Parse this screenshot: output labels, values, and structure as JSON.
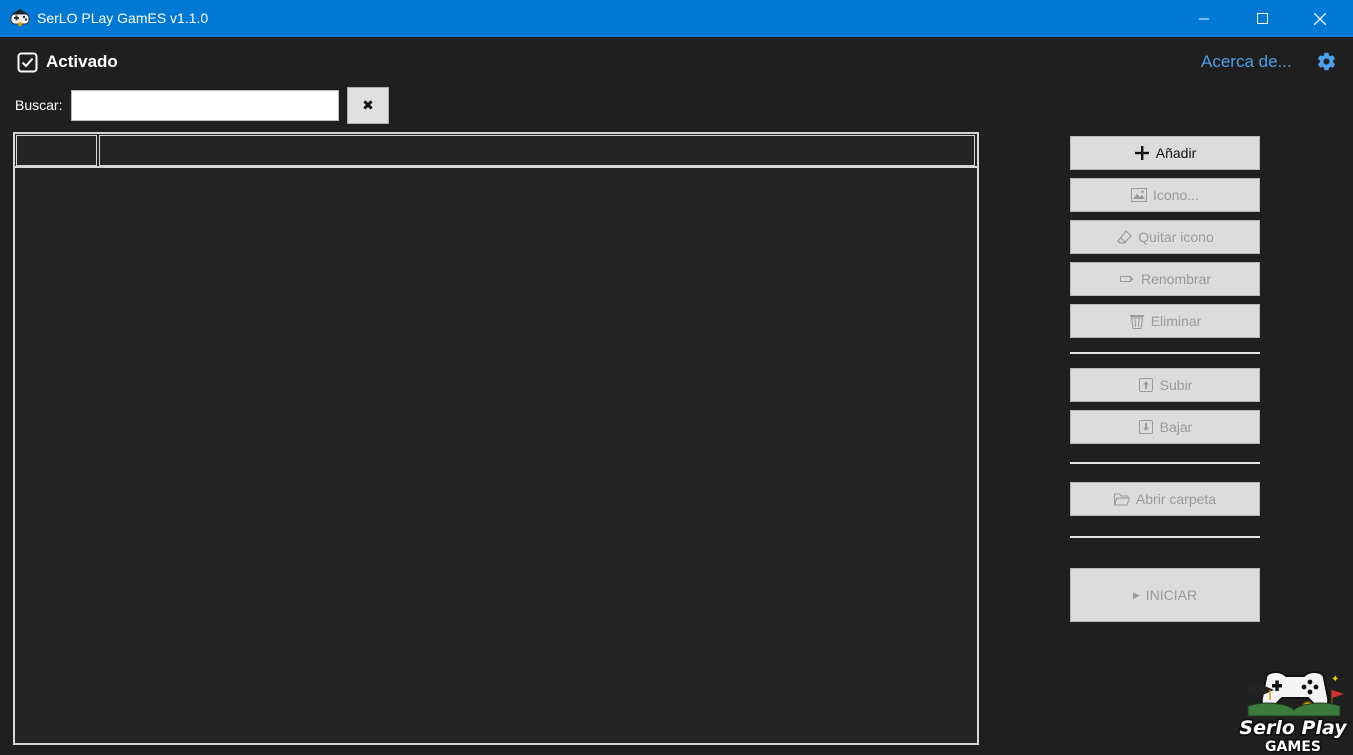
{
  "window": {
    "title": "SerLO PLay GamES v1.1.0",
    "accent_color": "#0078d4"
  },
  "header": {
    "activado_label": "Activado",
    "activado_checked": true,
    "about_link": "Acerca de..."
  },
  "search": {
    "label": "Buscar:",
    "value": "",
    "clear_icon": "x-icon"
  },
  "list": {
    "columns": [
      "",
      ""
    ],
    "rows": []
  },
  "actions": {
    "add": "Añadir",
    "icon": "Icono...",
    "remove_icon": "Quitar icono",
    "rename": "Renombrar",
    "delete": "Eliminar",
    "move_up": "Subir",
    "move_down": "Bajar",
    "open_folder": "Abrir carpeta",
    "start": "INICIAR"
  },
  "logo": {
    "line1": "Serlo Play",
    "line2": "GAMES"
  }
}
